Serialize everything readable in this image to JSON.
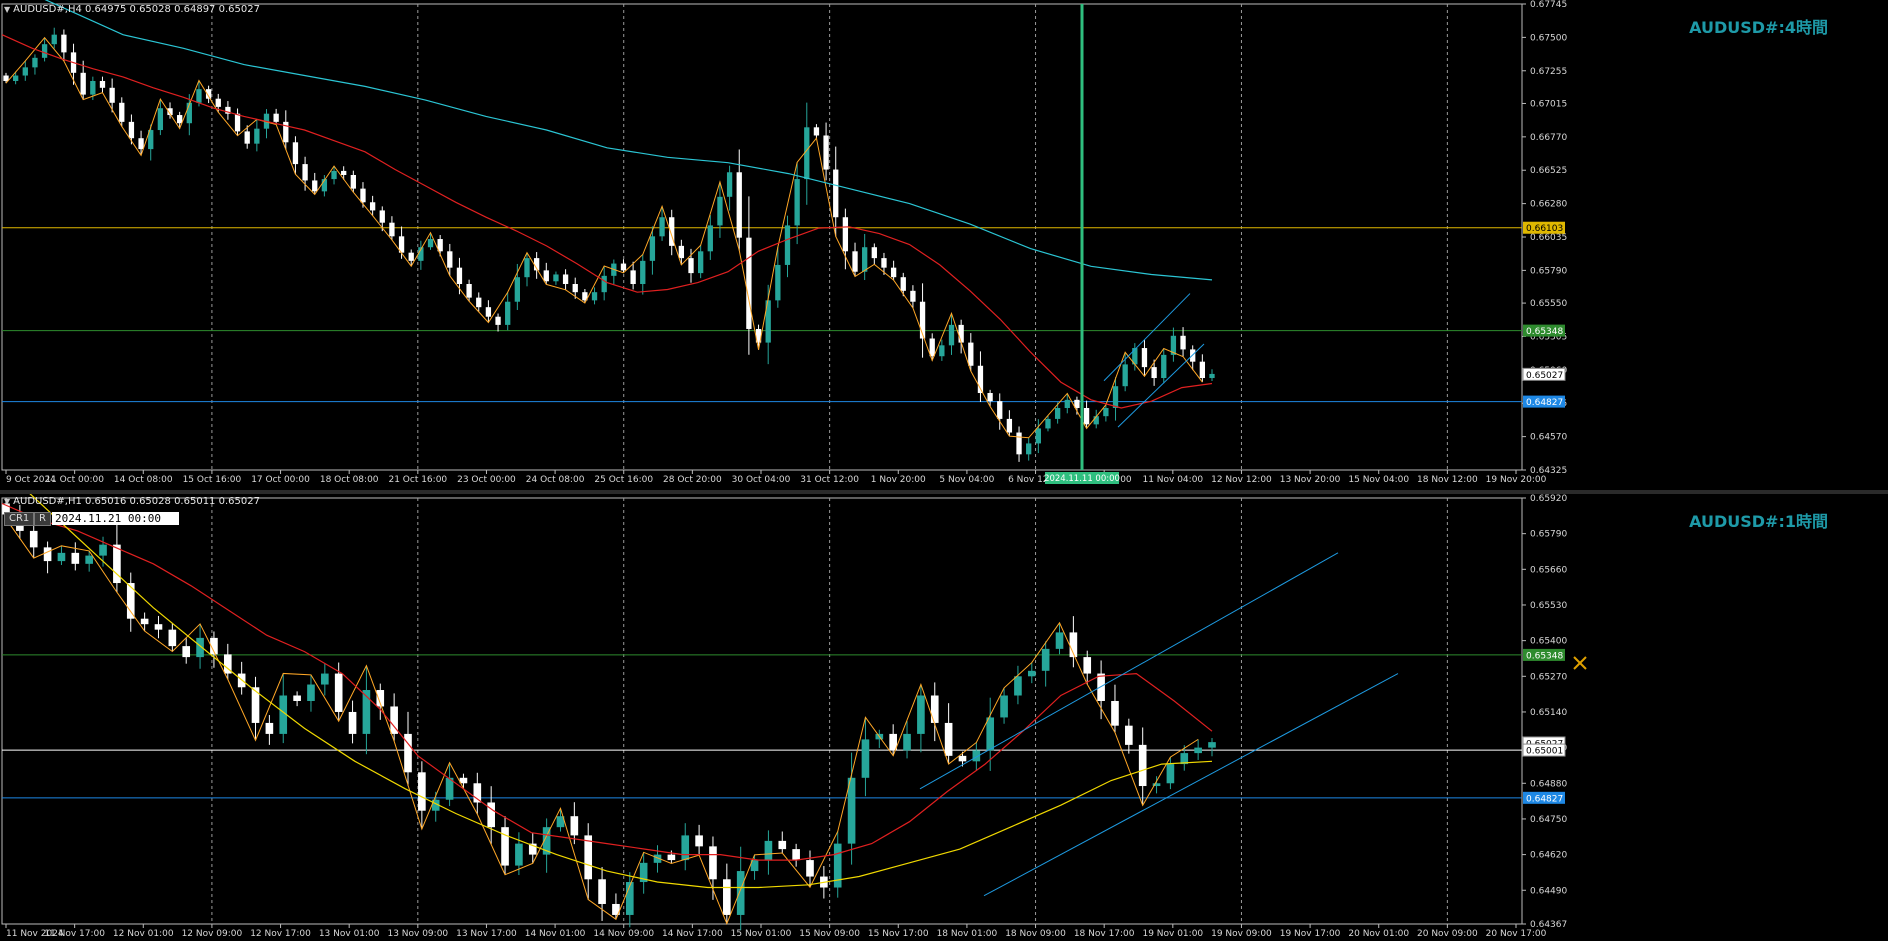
{
  "colors": {
    "up": "#26a69a",
    "down": "#ffffff",
    "ma_red": "#e02020",
    "ma_cyan": "#2bc5d4",
    "ma_yellow": "#f0d800",
    "zigzag": "#ffa726",
    "hline_yellow": "#e0b800",
    "hline_green": "#2e8b2e",
    "hline_blue": "#1e88e5",
    "hline_white": "#ffffff",
    "channel": "#1e9ae0",
    "vline": "#2fbf7f"
  },
  "charts": [
    {
      "id": "h4",
      "header": "AUDUSD#,H4  0.64975 0.65028 0.64897 0.65027",
      "watermark": "AUDUSD#:4時間",
      "chart_data": {
        "type": "candlestick",
        "symbol": "AUDUSD#",
        "timeframe": "H4",
        "ohlc_last": {
          "open": 0.64975,
          "high": 0.65028,
          "low": 0.64897,
          "close": 0.65027
        },
        "ylim": [
          0.64325,
          0.67745
        ],
        "y_ticks": [
          "0.67745",
          "0.67500",
          "0.67255",
          "0.67015",
          "0.66770",
          "0.66525",
          "0.66280",
          "0.66035",
          "0.65790",
          "0.65550",
          "0.65305",
          "0.65060",
          "0.64815",
          "0.64570",
          "0.64325"
        ],
        "x_ticks": [
          "9 Oct 2024",
          "11 Oct 00:00",
          "14 Oct 08:00",
          "15 Oct 16:00",
          "17 Oct 00:00",
          "18 Oct 08:00",
          "21 Oct 16:00",
          "23 Oct 00:00",
          "24 Oct 08:00",
          "25 Oct 16:00",
          "28 Oct 20:00",
          "30 Oct 04:00",
          "31 Oct 12:00",
          "1 Nov 20:00",
          "5 Nov 04:00",
          "6 Nov 12:00",
          "7 Nov 20:00",
          "11 Nov 04:00",
          "12 Nov 12:00",
          "13 Nov 20:00",
          "15 Nov 04:00",
          "18 Nov 12:00",
          "19 Nov 20:00"
        ],
        "price_tags": [
          {
            "label": "0.66103",
            "value": 0.66103,
            "kind": "yellow"
          },
          {
            "label": "0.65348",
            "value": 0.65348,
            "kind": "green"
          },
          {
            "label": "0.65027",
            "value": 0.65027,
            "kind": "white"
          },
          {
            "label": "0.64827",
            "value": 0.64827,
            "kind": "blue"
          }
        ],
        "cursor_date": "2024.11.11 00:00",
        "series": [
          {
            "kind": "close",
            "values": [
              0.6718,
              0.6722,
              0.6728,
              0.6735,
              0.6745,
              0.6752,
              0.6739,
              0.6724,
              0.6708,
              0.6718,
              0.6713,
              0.6702,
              0.6688,
              0.6676,
              0.6668,
              0.6682,
              0.6698,
              0.6693,
              0.6687,
              0.6702,
              0.6712,
              0.6705,
              0.6699,
              0.6694,
              0.6681,
              0.6672,
              0.6683,
              0.6694,
              0.6688,
              0.6673,
              0.6657,
              0.6645,
              0.6637,
              0.6646,
              0.6652,
              0.6649,
              0.6639,
              0.6629,
              0.6623,
              0.6614,
              0.6604,
              0.6592,
              0.6586,
              0.6596,
              0.6602,
              0.6593,
              0.6581,
              0.6569,
              0.6559,
              0.6552,
              0.6545,
              0.6539,
              0.6556,
              0.6574,
              0.6588,
              0.6579,
              0.6571,
              0.6576,
              0.6569,
              0.6563,
              0.6557,
              0.6563,
              0.6575,
              0.6584,
              0.6579,
              0.6569,
              0.6586,
              0.6604,
              0.6618,
              0.6597,
              0.6588,
              0.6577,
              0.6593,
              0.6612,
              0.6633,
              0.6651,
              0.6603,
              0.6536,
              0.6526,
              0.6557,
              0.6583,
              0.6612,
              0.6646,
              0.6684,
              0.6678,
              0.6653,
              0.6618,
              0.6593,
              0.6578,
              0.6596,
              0.6588,
              0.6581,
              0.6574,
              0.6564,
              0.6556,
              0.6529,
              0.6516,
              0.6524,
              0.6539,
              0.6526,
              0.6509,
              0.6489,
              0.6483,
              0.647,
              0.646,
              0.6444,
              0.6452,
              0.6463,
              0.647,
              0.6478,
              0.6484,
              0.6478,
              0.6466,
              0.6472,
              0.6478,
              0.6494,
              0.651,
              0.6522,
              0.6508,
              0.65,
              0.6517,
              0.6531,
              0.6521,
              0.6512,
              0.65,
              0.6503
            ]
          },
          {
            "kind": "ma",
            "name": "",
            "values": [
              0.6752,
              0.6742,
              0.6734,
              0.6727,
              0.6721,
              0.6713,
              0.6706,
              0.6698,
              0.6692,
              0.6687,
              0.6682,
              0.6674,
              0.6666,
              0.6653,
              0.6641,
              0.6629,
              0.6618,
              0.6608,
              0.6597,
              0.6584,
              0.657,
              0.6563,
              0.6565,
              0.657,
              0.6578,
              0.6593,
              0.6602,
              0.661,
              0.6611,
              0.6606,
              0.6598,
              0.6583,
              0.6564,
              0.6543,
              0.6519,
              0.6497,
              0.6484,
              0.6478,
              0.6483,
              0.6493,
              0.6496
            ]
          },
          {
            "kind": "ma",
            "name": "",
            "values": [
              0.6792,
              0.6772,
              0.6752,
              0.6742,
              0.673,
              0.6722,
              0.6714,
              0.6704,
              0.6692,
              0.6682,
              0.6669,
              0.6662,
              0.6658,
              0.665,
              0.6639,
              0.6628,
              0.6613,
              0.6595,
              0.6582,
              0.6576,
              0.6572
            ]
          }
        ]
      }
    },
    {
      "id": "h1",
      "header": "AUDUSD#,H1  0.65016 0.65028 0.65011 0.65027",
      "watermark": "AUDUSD#:1時間",
      "buttons": [
        "CR1",
        "R"
      ],
      "date_input": "2024.11.21 00:00",
      "chart_data": {
        "type": "candlestick",
        "symbol": "AUDUSD#",
        "timeframe": "H1",
        "ohlc_last": {
          "open": 0.65016,
          "high": 0.65028,
          "low": 0.65011,
          "close": 0.65027
        },
        "ylim": [
          0.64367,
          0.6592
        ],
        "y_ticks": [
          "0.65920",
          "0.65790",
          "0.65660",
          "0.65530",
          "0.65400",
          "0.65270",
          "0.65140",
          "0.65010",
          "0.64880",
          "0.64750",
          "0.64620",
          "0.64490",
          "0.64367"
        ],
        "x_ticks": [
          "11 Nov 2024",
          "11 Nov 17:00",
          "12 Nov 01:00",
          "12 Nov 09:00",
          "12 Nov 17:00",
          "13 Nov 01:00",
          "13 Nov 09:00",
          "13 Nov 17:00",
          "14 Nov 01:00",
          "14 Nov 09:00",
          "14 Nov 17:00",
          "15 Nov 01:00",
          "15 Nov 09:00",
          "15 Nov 17:00",
          "18 Nov 01:00",
          "18 Nov 09:00",
          "18 Nov 17:00",
          "19 Nov 01:00",
          "19 Nov 09:00",
          "19 Nov 17:00",
          "20 Nov 01:00",
          "20 Nov 09:00",
          "20 Nov 17:00"
        ],
        "price_tags": [
          {
            "label": "0.65348",
            "value": 0.65348,
            "kind": "green"
          },
          {
            "label": "0.65027",
            "value": 0.65027,
            "kind": "white"
          },
          {
            "label": "0.65001",
            "value": 0.65001,
            "kind": "white"
          },
          {
            "label": "0.64827",
            "value": 0.64827,
            "kind": "blue"
          }
        ],
        "series": [
          {
            "kind": "close",
            "values": [
              0.6586,
              0.658,
              0.6574,
              0.6569,
              0.6572,
              0.6568,
              0.6571,
              0.6575,
              0.6561,
              0.6548,
              0.6546,
              0.6544,
              0.6538,
              0.6534,
              0.6541,
              0.6535,
              0.6528,
              0.6523,
              0.651,
              0.6506,
              0.652,
              0.6518,
              0.6524,
              0.6528,
              0.6514,
              0.6506,
              0.6522,
              0.6516,
              0.6506,
              0.6492,
              0.6478,
              0.6482,
              0.649,
              0.6488,
              0.6481,
              0.6472,
              0.6458,
              0.6466,
              0.6462,
              0.6472,
              0.6476,
              0.6469,
              0.6453,
              0.6444,
              0.644,
              0.6452,
              0.6459,
              0.6462,
              0.646,
              0.6469,
              0.6465,
              0.6453,
              0.644,
              0.6456,
              0.646,
              0.6467,
              0.6464,
              0.646,
              0.6454,
              0.645,
              0.6466,
              0.649,
              0.6504,
              0.6506,
              0.65,
              0.6506,
              0.652,
              0.651,
              0.6498,
              0.6496,
              0.65,
              0.6512,
              0.652,
              0.6527,
              0.6529,
              0.6537,
              0.6543,
              0.6534,
              0.6528,
              0.6518,
              0.6509,
              0.6502,
              0.6487,
              0.6488,
              0.6495,
              0.6499,
              0.6501,
              0.6503
            ]
          },
          {
            "kind": "ma",
            "name": "",
            "values": [
              0.659,
              0.6584,
              0.658,
              0.6574,
              0.6568,
              0.656,
              0.6551,
              0.6542,
              0.6536,
              0.6528,
              0.6515,
              0.6498,
              0.6488,
              0.6478,
              0.647,
              0.6468,
              0.6466,
              0.6464,
              0.6462,
              0.6462,
              0.646,
              0.646,
              0.6462,
              0.6466,
              0.6474,
              0.6485,
              0.6495,
              0.6507,
              0.652,
              0.6527,
              0.6528,
              0.6518,
              0.6507
            ]
          },
          {
            "kind": "ma",
            "name": "",
            "values": [
              0.6603,
              0.6586,
              0.6569,
              0.6552,
              0.6537,
              0.6522,
              0.6508,
              0.6496,
              0.6486,
              0.6477,
              0.6469,
              0.6462,
              0.6456,
              0.6452,
              0.645,
              0.645,
              0.6451,
              0.6454,
              0.6459,
              0.6464,
              0.6472,
              0.648,
              0.6489,
              0.6495,
              0.6496
            ]
          }
        ]
      }
    }
  ]
}
